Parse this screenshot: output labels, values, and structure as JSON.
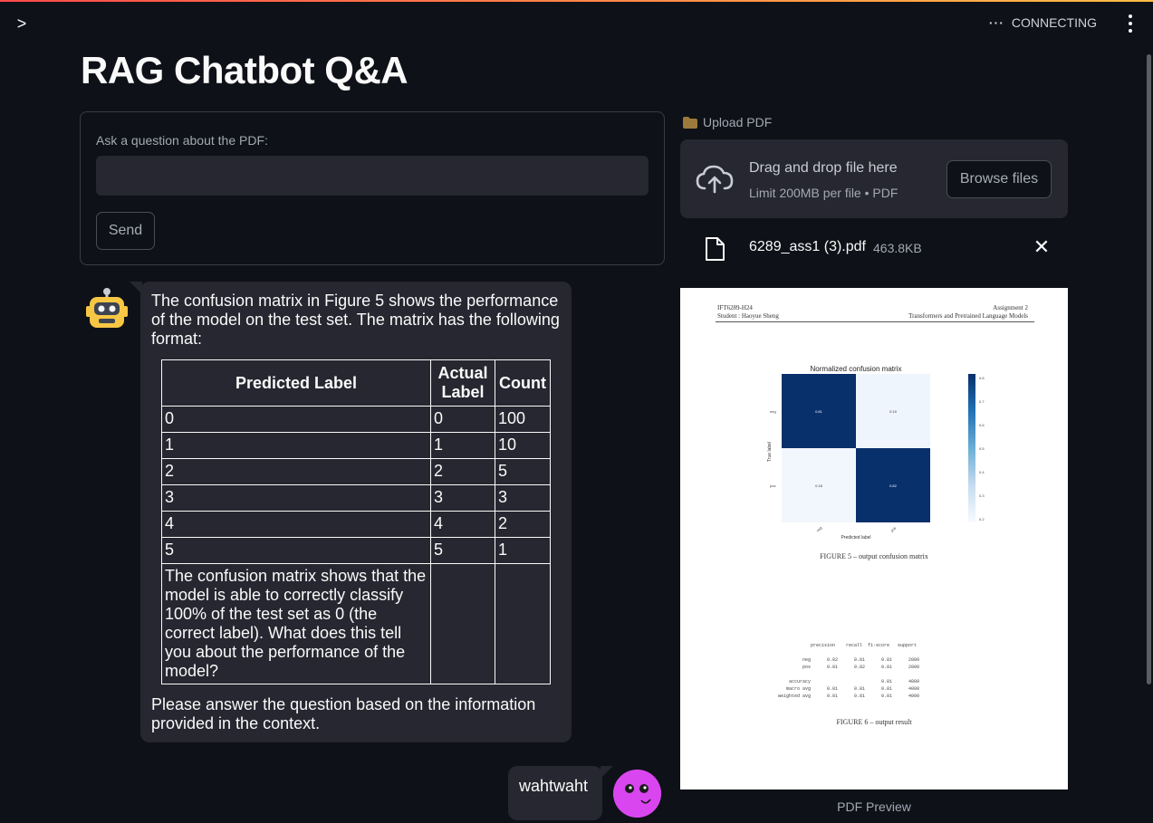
{
  "header": {
    "status_text": "CONNECTING",
    "sidebar_toggle_glyph": ">",
    "menu_icon": "kebab-icon",
    "accent_gradient": [
      "#ff4b4b",
      "#ffbd45"
    ]
  },
  "page": {
    "title": "RAG Chatbot Q&A"
  },
  "question_form": {
    "label": "Ask a question about the PDF:",
    "input_value": "",
    "send_label": "Send"
  },
  "chat": {
    "bot_message": {
      "intro": "The confusion matrix in Figure 5 shows the performance of the model on the test set. The matrix has the following format:",
      "table": {
        "headers": [
          "Predicted Label",
          "Actual Label",
          "Count"
        ],
        "rows": [
          [
            "0",
            "0",
            "100"
          ],
          [
            "1",
            "1",
            "10"
          ],
          [
            "2",
            "2",
            "5"
          ],
          [
            "3",
            "3",
            "3"
          ],
          [
            "4",
            "4",
            "2"
          ],
          [
            "5",
            "5",
            "1"
          ],
          [
            "The confusion matrix shows that the model is able to correctly classify 100% of the test set as 0 (the correct label). What does this tell you about the performance of the model?",
            "",
            ""
          ]
        ]
      },
      "outro": "Please answer the question based on the information provided in the context."
    },
    "user_message": {
      "text": "wahtwaht",
      "avatar_color": "#d946ef"
    }
  },
  "upload": {
    "label": "Upload PDF",
    "dropzone_main": "Drag and drop file here",
    "dropzone_sub": "Limit 200MB per file • PDF",
    "browse_label": "Browse files",
    "file": {
      "name": "6289_ass1 (3).pdf",
      "size": "463.8KB"
    }
  },
  "pdf_preview": {
    "header_left_1": "IFT6289-H24",
    "header_left_2": "Student : Haoyue Sheng",
    "header_right_1": "Assignment 2",
    "header_right_2": "Transformers and Pretrained Language Models",
    "cm_title": "Normalized confusion matrix",
    "cm_values": [
      [
        "0.81",
        "0.19"
      ],
      [
        "0.18",
        "0.82"
      ]
    ],
    "cm_row_labels": [
      "neg",
      "pos"
    ],
    "cm_col_labels": [
      "neg",
      "pos"
    ],
    "cm_xlabel": "Predicted label",
    "cm_ylabel": "True label",
    "colorbar_ticks": [
      "0.8",
      "0.7",
      "0.6",
      "0.5",
      "0.4",
      "0.3",
      "0.2"
    ],
    "fig5_caption": "FIGURE 5 – output confusion matrix",
    "report_text": "            precision    recall  f1-score   support\n\n         neg      0.82      0.81      0.81      2000\n         pos      0.81      0.82      0.81      2000\n\n    accuracy                          0.81      4000\n   macro avg      0.81      0.81      0.81      4000\nweighted avg      0.81      0.81      0.81      4000",
    "fig6_caption": "FIGURE 6 – output result",
    "caption": "PDF Preview"
  }
}
